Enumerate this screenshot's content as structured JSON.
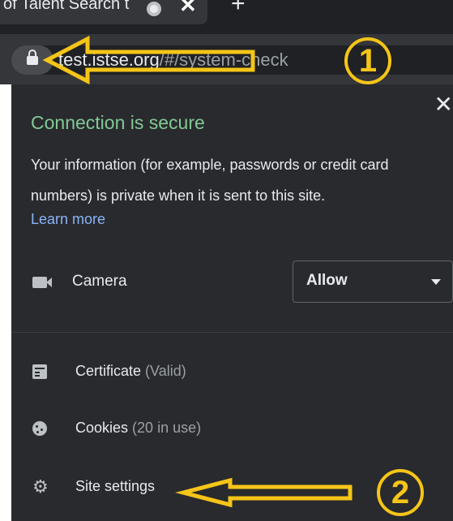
{
  "browser": {
    "tab_title": "of Talent Search t",
    "tab_close": "✕",
    "new_tab": "+",
    "url_host": "test.istse.org",
    "url_path": "/#/system-check"
  },
  "popup": {
    "close": "✕",
    "title": "Connection is secure",
    "description": "Your information (for example, passwords or credit card numbers) is private when it is sent to this site.",
    "learn_more": "Learn more",
    "camera_label": "Camera",
    "camera_permission": "Allow",
    "certificate_label": "Certificate",
    "certificate_status": "(Valid)",
    "cookies_label": "Cookies",
    "cookies_status": "(20 in use)",
    "site_settings_label": "Site settings"
  },
  "annotations": {
    "marker_1": "1",
    "marker_2": "2",
    "color": "#f5c518"
  },
  "icons": [
    "lock-icon",
    "camera-icon",
    "certificate-icon",
    "cookie-icon",
    "gear-icon",
    "close-icon",
    "chevron-down-icon"
  ]
}
